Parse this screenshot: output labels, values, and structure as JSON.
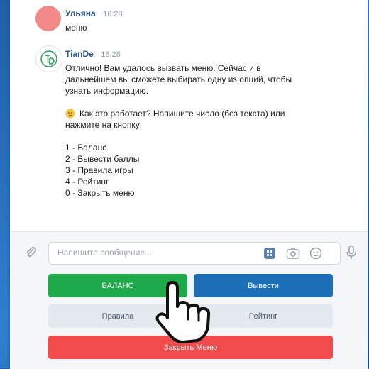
{
  "messages": [
    {
      "author": "Ульяна",
      "time": "16:28",
      "text": "меню"
    },
    {
      "author": "TianDe",
      "time": "16:28",
      "lines": [
        "Отлично! Вам удалось вызвать меню. Сейчас и в",
        "дальнейшем вы сможете выбирать одну из опций, чтобы",
        "узнать информацию.",
        "",
        "Как это работает? Напишите число (без текста) или",
        "нажмите на кнопку:",
        "",
        "1 - Баланс",
        "2 - Вывести баллы",
        "3 - Правила игры",
        "4 - Рейтинг",
        "0 - Закрыть меню"
      ]
    }
  ],
  "composer": {
    "placeholder": "Напишите сообщение..."
  },
  "buttons": {
    "balance": "БАЛАНС",
    "withdraw": "Вывести",
    "rules": "Правила",
    "rating": "Рейтинг",
    "close_menu": "Закрыть Меню"
  },
  "icons": {
    "attach": "paperclip-icon",
    "keyboard": "keyboard-icon",
    "camera": "camera-icon",
    "emoji": "smile-icon",
    "mic": "microphone-icon",
    "thinking": "thinking-emoji-icon",
    "hand": "pointing-hand-icon"
  },
  "colors": {
    "green": "#1ea94a",
    "blue": "#1c6fb7",
    "red": "#f24b4b",
    "link": "#2a5885"
  }
}
